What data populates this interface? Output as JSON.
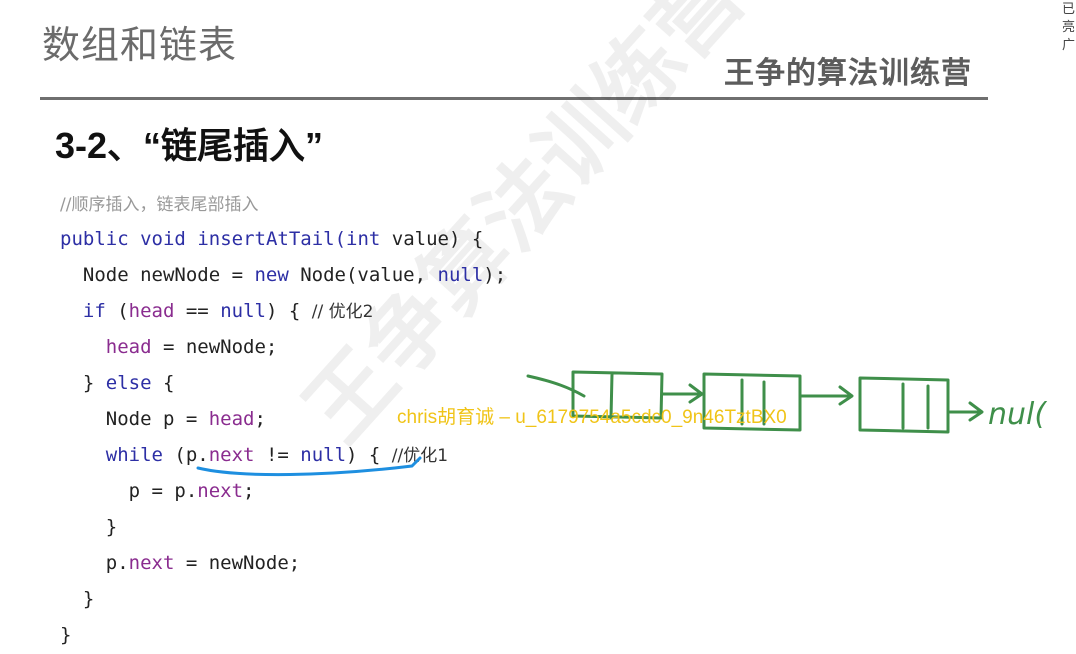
{
  "slide": {
    "topic": "数组和链表",
    "brand": "王争的算法训练营",
    "section_title": "3-2、“链尾插入”",
    "watermark_bg": "王争算法训练营",
    "edge_text": "已\n亮\n广"
  },
  "code": {
    "comment": "//顺序插入，链表尾部插入",
    "l1": {
      "kw1": "public",
      "kw2": "void",
      "name": "insertAtTail(",
      "kw3": "int",
      "rest": " value) {"
    },
    "l2": {
      "a": "  Node newNode = ",
      "kw": "new",
      "b": " Node(value, ",
      "nul": "null",
      "c": ");"
    },
    "l3": {
      "kw": "  if",
      "a": " (",
      "fld": "head",
      "b": " == ",
      "nul": "null",
      "c": ") { ",
      "cm": "// 优化2"
    },
    "l4": {
      "ind": "    ",
      "fld": "head",
      "a": " = newNode;"
    },
    "l5": {
      "a": "  } ",
      "kw": "else",
      "b": " {"
    },
    "l6": {
      "a": "    Node p = ",
      "fld": "head",
      "b": ";"
    },
    "l7": {
      "ind": "    ",
      "kw": "while",
      "a": " (p.",
      "fld": "next",
      "b": " != ",
      "nul": "null",
      "c": ") { ",
      "cm": "//优化1"
    },
    "l8": {
      "a": "      p = p.",
      "fld": "next",
      "b": ";"
    },
    "l9": {
      "a": "    }"
    },
    "l10": {
      "a": "    p.",
      "fld": "next",
      "b": " = newNode;"
    },
    "l11": {
      "a": "  }"
    },
    "l12": {
      "a": "}"
    }
  },
  "overlay_watermark": "chris胡育诚 – u_6179754a5cdc0_9n46TztBX0",
  "annotation": {
    "null_text": "nul("
  },
  "colors": {
    "keyword": "#2d2fa5",
    "field": "#8a2c8f",
    "ink_green": "#3f8f4a",
    "ink_blue": "#1e8fe0",
    "overlay": "#f0c418"
  }
}
